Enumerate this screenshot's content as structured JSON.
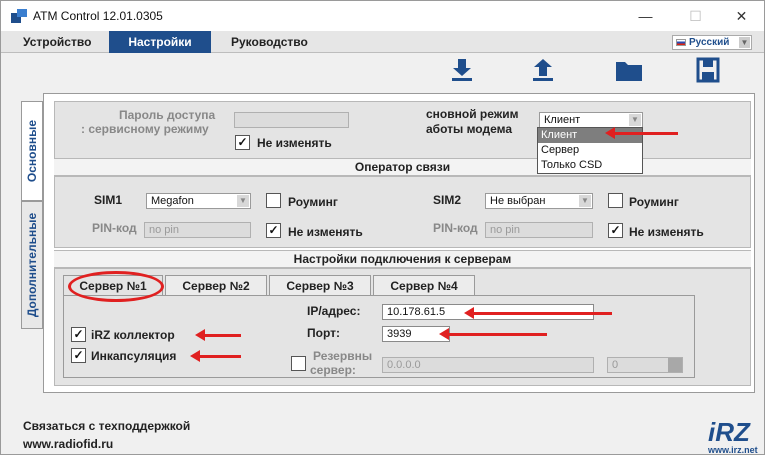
{
  "window": {
    "title": "ATM Control 12.01.0305",
    "controls": [
      "—",
      "☐",
      "✕"
    ]
  },
  "menu": {
    "items": [
      "Устройство",
      "Настройки",
      "Руководство"
    ],
    "active": "Настройки",
    "language": "Русский"
  },
  "toolbar": {
    "icons": [
      "download-icon",
      "upload-icon",
      "folder-icon",
      "save-icon"
    ]
  },
  "side_tabs": {
    "main": "Основные",
    "extra": "Дополнительные"
  },
  "access": {
    "password_label_1": "Пароль доступа",
    "password_label_2": ": сервисному режиму",
    "no_change": "Не изменять",
    "mode_label_1": "сновной режим",
    "mode_label_2": "аботы модема",
    "mode_value": "Клиент",
    "mode_options": [
      "Клиент",
      "Сервер",
      "Только CSD"
    ]
  },
  "operator": {
    "title": "Оператор связи",
    "sim1_label": "SIM1",
    "sim1_value": "Megafon",
    "sim2_label": "SIM2",
    "sim2_value": "Не выбран",
    "roaming": "Роуминг",
    "pin_label": "PIN-код",
    "pin_placeholder": "no pin",
    "no_change": "Не изменять"
  },
  "servers": {
    "title": "Настройки подключения к серверам",
    "tabs": [
      "Сервер №1",
      "Сервер №2",
      "Сервер №3",
      "Сервер №4"
    ],
    "collector": "iRZ коллектор",
    "encapsulation": "Инкапсуляция",
    "ip_label": "IP/адрес:",
    "ip_value": "10.178.61.5",
    "port_label": "Порт:",
    "port_value": "3939",
    "backup_label_1": "Резервны",
    "backup_label_2": "сервер:",
    "backup_ip": "0.0.0.0",
    "backup_port": "0"
  },
  "footer": {
    "support": "Связаться с техподдержкой",
    "site": "www.radiofid.ru",
    "logo_text": "iRZ",
    "logo_site": "www.irz.net"
  },
  "colors": {
    "accent": "#1f4e8c",
    "annotation": "#e02020"
  }
}
